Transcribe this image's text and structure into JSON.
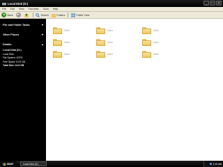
{
  "window": {
    "title": "Local Disk (D:)"
  },
  "menu": [
    "File",
    "Edit",
    "View",
    "Favorites",
    "Tools",
    "Help"
  ],
  "toolbar": {
    "back": "Back",
    "search": "Search",
    "folders": "Folders",
    "views": "Folder View"
  },
  "sidebar": {
    "file_tasks": "File and Folder Tasks",
    "other_places": "Other Places",
    "details": {
      "title": "Details",
      "drive_name": "Local Disk (D:)",
      "drive_type": "Local Disk",
      "file_system": "File System: NTFS",
      "free_space": "Free Space: 8.03 GB",
      "total_size": "Total Size: 14.6 GB"
    }
  },
  "files": [
    {
      "name": "folder"
    },
    {
      "name": "folder"
    },
    {
      "name": "folder"
    },
    {
      "name": "folder"
    },
    {
      "name": "folder"
    },
    {
      "name": "folder"
    },
    {
      "name": "folder"
    },
    {
      "name": "folder"
    },
    {
      "name": "folder"
    }
  ],
  "taskbar": {
    "start": "start",
    "task_label": "Local Disk (D:)",
    "clock": "3:10 AM"
  },
  "colors": {
    "folder": "#efc760",
    "chrome": "#000000",
    "menubar": "#ece9d8"
  }
}
